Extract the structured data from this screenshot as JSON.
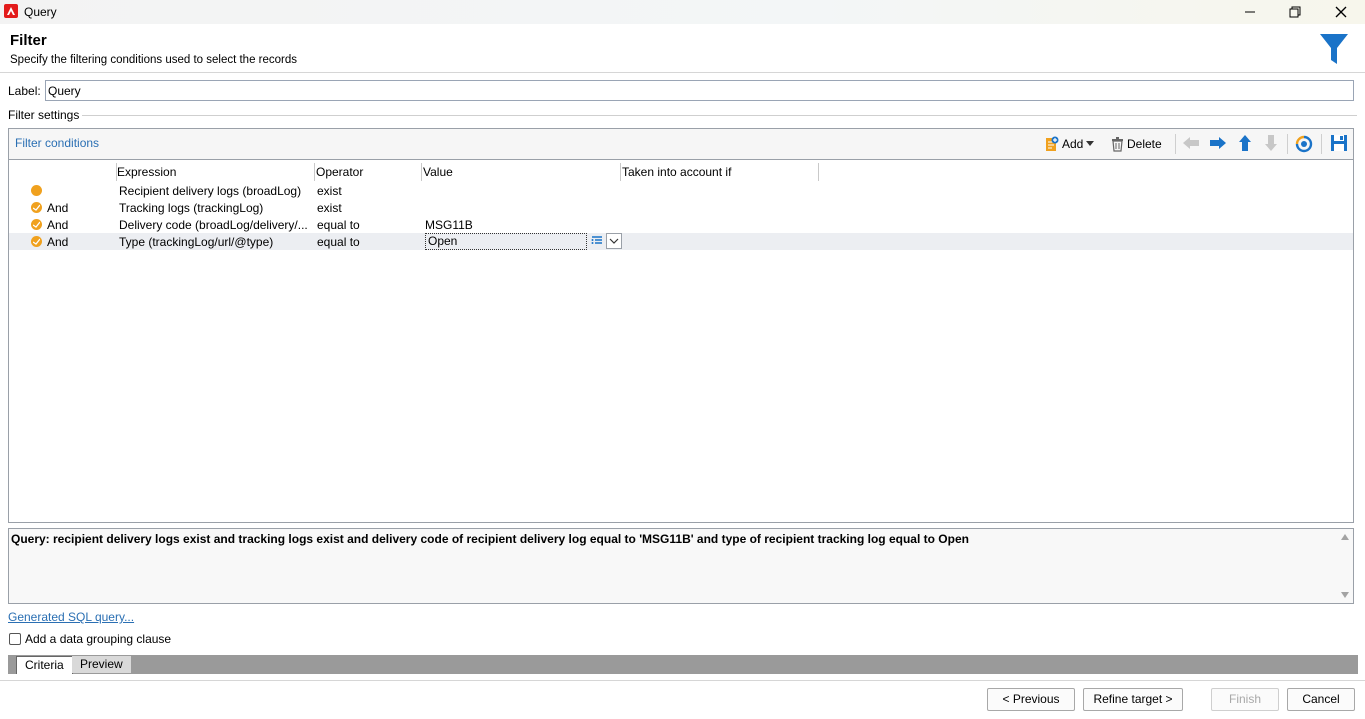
{
  "window": {
    "title": "Query"
  },
  "header": {
    "title": "Filter",
    "subtitle": "Specify the filtering conditions used to select the records"
  },
  "label_field": {
    "label": "Label:",
    "value": "Query"
  },
  "filter_settings": {
    "title": "Filter settings"
  },
  "filter_conditions": {
    "title": "Filter conditions",
    "toolbar": {
      "add": "Add",
      "delete": "Delete"
    },
    "columns": [
      "Expression",
      "Operator",
      "Value",
      "Taken into account if"
    ],
    "rows": [
      {
        "logic": "",
        "expression": "Recipient delivery logs (broadLog)",
        "operator": "exist",
        "value": ""
      },
      {
        "logic": "And",
        "expression": "Tracking logs (trackingLog)",
        "operator": "exist",
        "value": ""
      },
      {
        "logic": "And",
        "expression": "Delivery code (broadLog/delivery/...",
        "operator": "equal to",
        "value": "MSG11B"
      },
      {
        "logic": "And",
        "expression": "Type (trackingLog/url/@type)",
        "operator": "equal to",
        "value": "Open"
      }
    ]
  },
  "summary": {
    "text": "Query: recipient delivery logs exist and tracking logs exist and delivery code of recipient delivery log equal to 'MSG11B' and type of recipient tracking log equal to Open"
  },
  "sql_link": "Generated SQL query...",
  "grouping": {
    "label": "Add a data grouping clause",
    "checked": false
  },
  "tabs": [
    "Criteria",
    "Preview"
  ],
  "buttons": {
    "previous": "< Previous",
    "refine": "Refine target >",
    "finish": "Finish",
    "cancel": "Cancel"
  },
  "colors": {
    "accent": "#2a6fb3",
    "condition_icon": "#f0a11e",
    "funnel": "#1a73c8"
  }
}
